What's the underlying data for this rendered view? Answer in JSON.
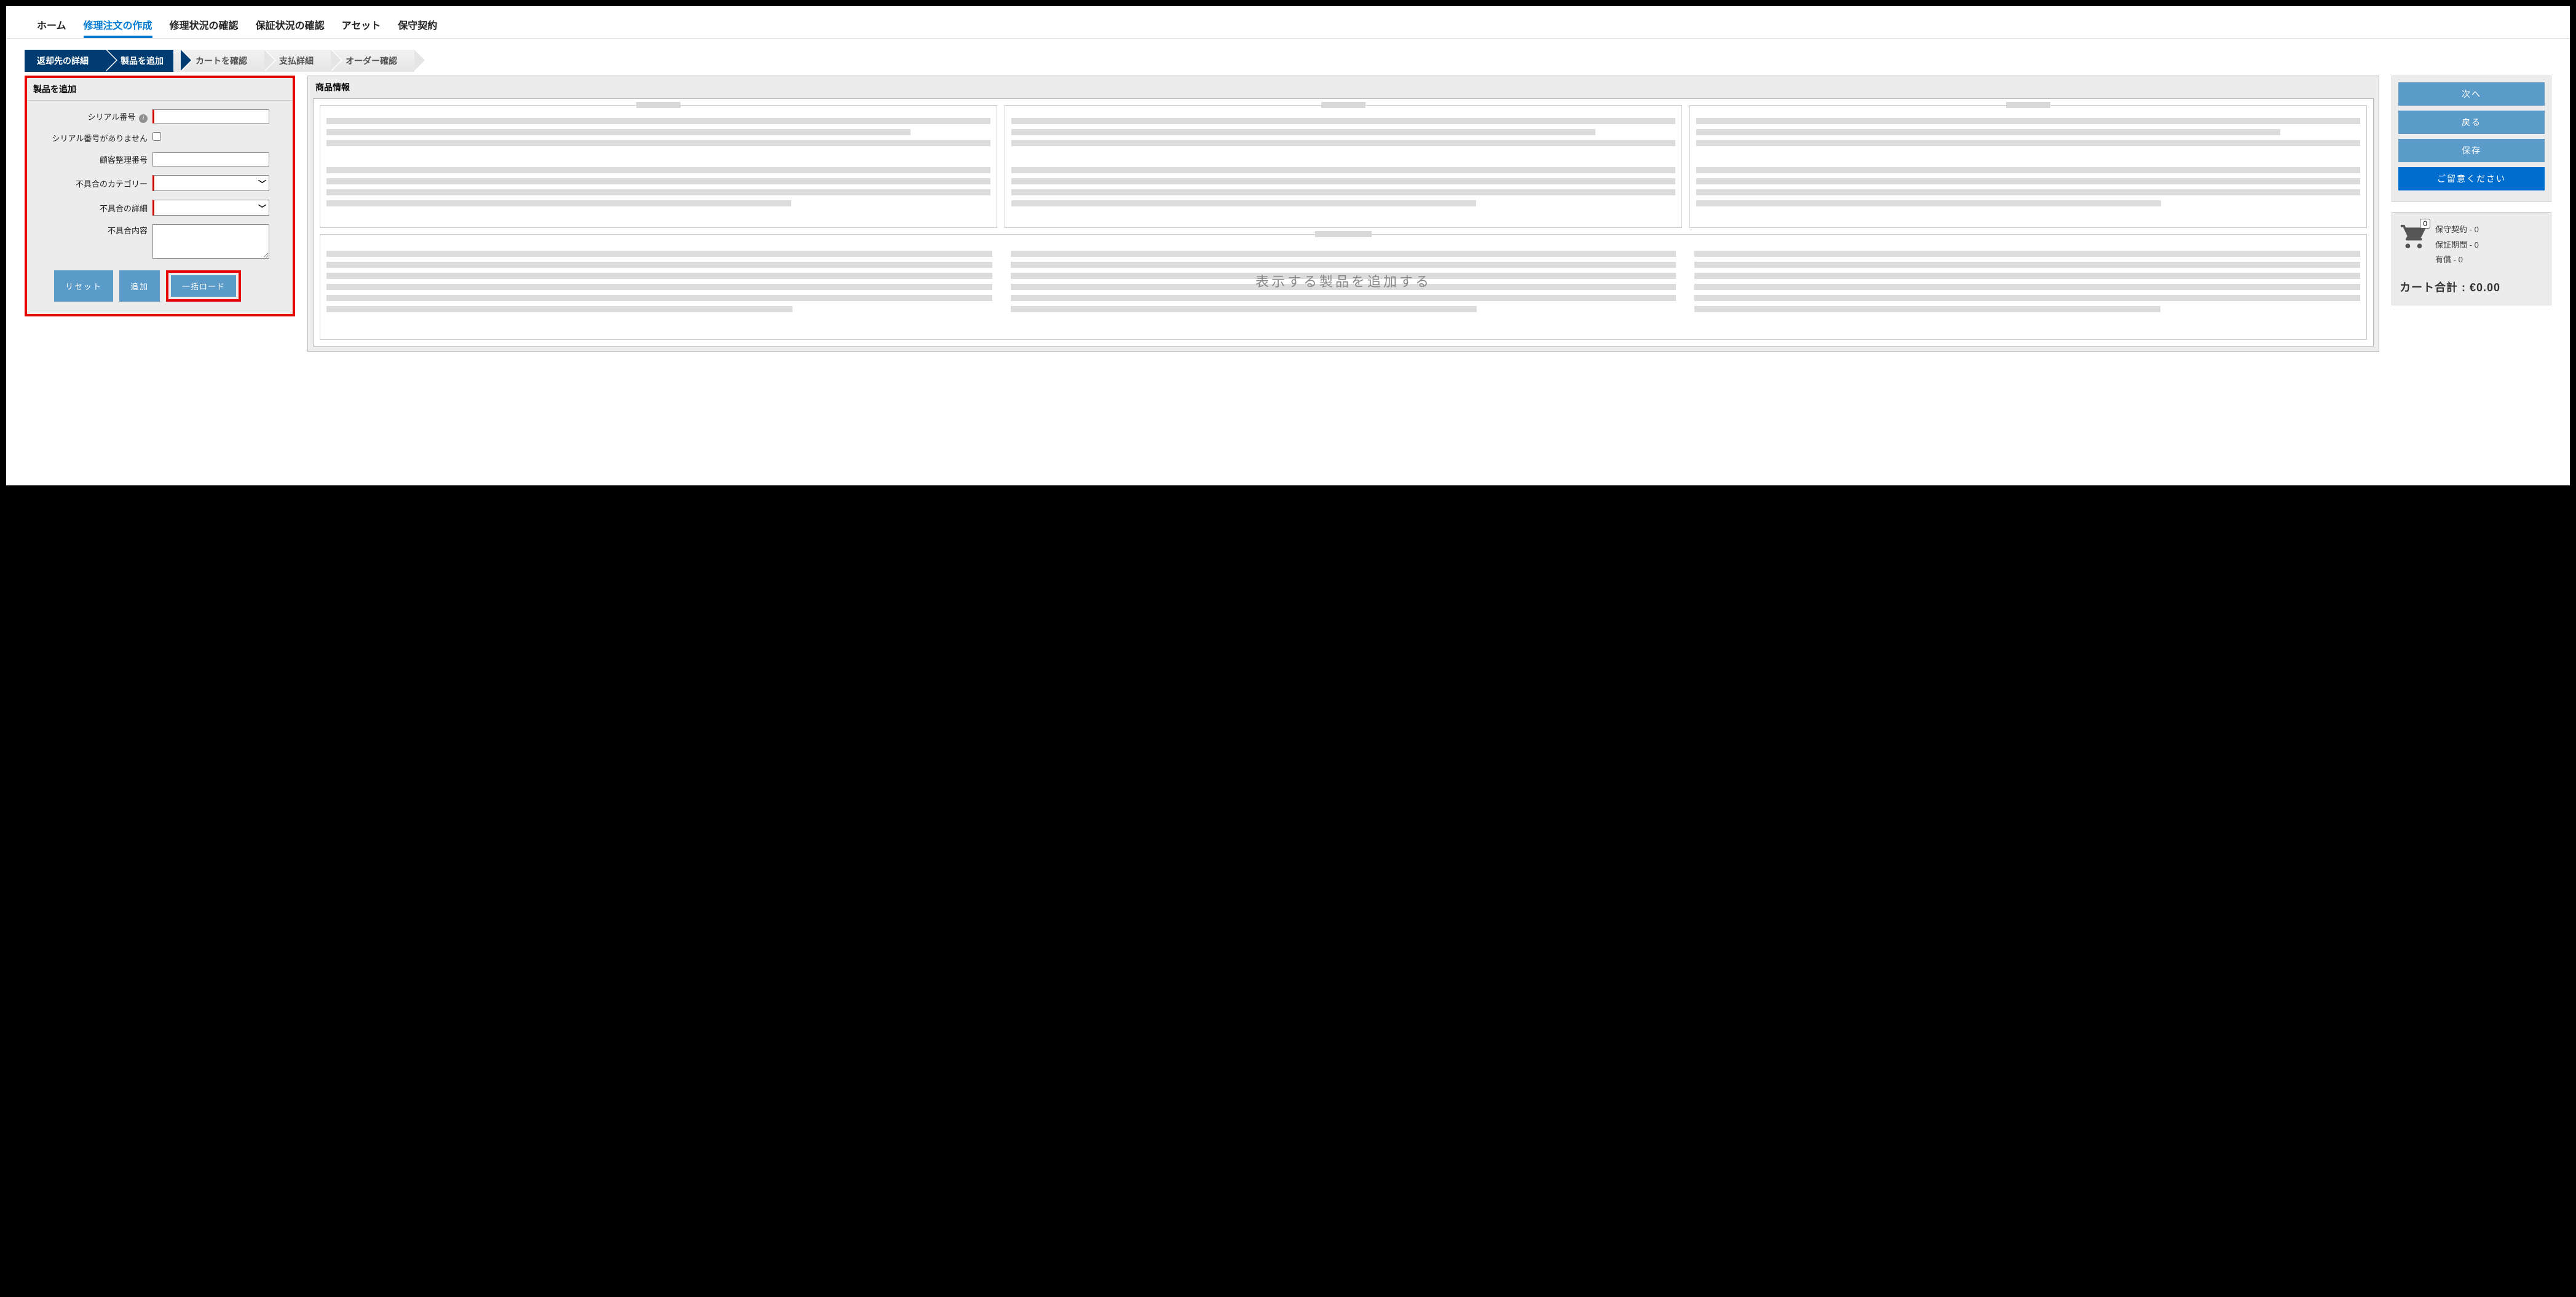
{
  "topnav": {
    "items": [
      {
        "label": "ホーム"
      },
      {
        "label": "修理注文の作成"
      },
      {
        "label": "修理状況の確認"
      },
      {
        "label": "保証状況の確認"
      },
      {
        "label": "アセット"
      },
      {
        "label": "保守契約"
      }
    ],
    "active_index": 1
  },
  "steps": {
    "items": [
      {
        "label": "返却先の詳細",
        "state": "done"
      },
      {
        "label": "製品を追加",
        "state": "done"
      },
      {
        "label": "カートを確認",
        "state": "todo"
      },
      {
        "label": "支払詳細",
        "state": "todo"
      },
      {
        "label": "オーダー確認",
        "state": "todo"
      }
    ]
  },
  "form": {
    "title": "製品を追加",
    "fields": {
      "serial": {
        "label": "シリアル番号",
        "value": ""
      },
      "no_serial": {
        "label": "シリアル番号がありません",
        "checked": false
      },
      "customer_ref": {
        "label": "顧客整理番号",
        "value": ""
      },
      "fault_category": {
        "label": "不具合のカテゴリー",
        "value": ""
      },
      "fault_detail": {
        "label": "不具合の詳細",
        "value": ""
      },
      "fault_text": {
        "label": "不具合内容",
        "value": ""
      }
    },
    "buttons": {
      "reset": "リセット",
      "add": "追加",
      "bulk": "一括ロード"
    }
  },
  "product_info": {
    "title": "商品情報",
    "empty_message": "表示する製品を追加する"
  },
  "sidebar": {
    "next_label": "次へ",
    "back_label": "戻る",
    "save_label": "保存",
    "notice_label": "ご留意ください"
  },
  "cart": {
    "count": "0",
    "lines": {
      "contract": {
        "label": "保守契約",
        "value": "0"
      },
      "warranty": {
        "label": "保証期間",
        "value": "0"
      },
      "paid": {
        "label": "有償",
        "value": "0"
      }
    },
    "separator": " - ",
    "total_label": "カート合計 : ",
    "total_value": "€0.00"
  }
}
